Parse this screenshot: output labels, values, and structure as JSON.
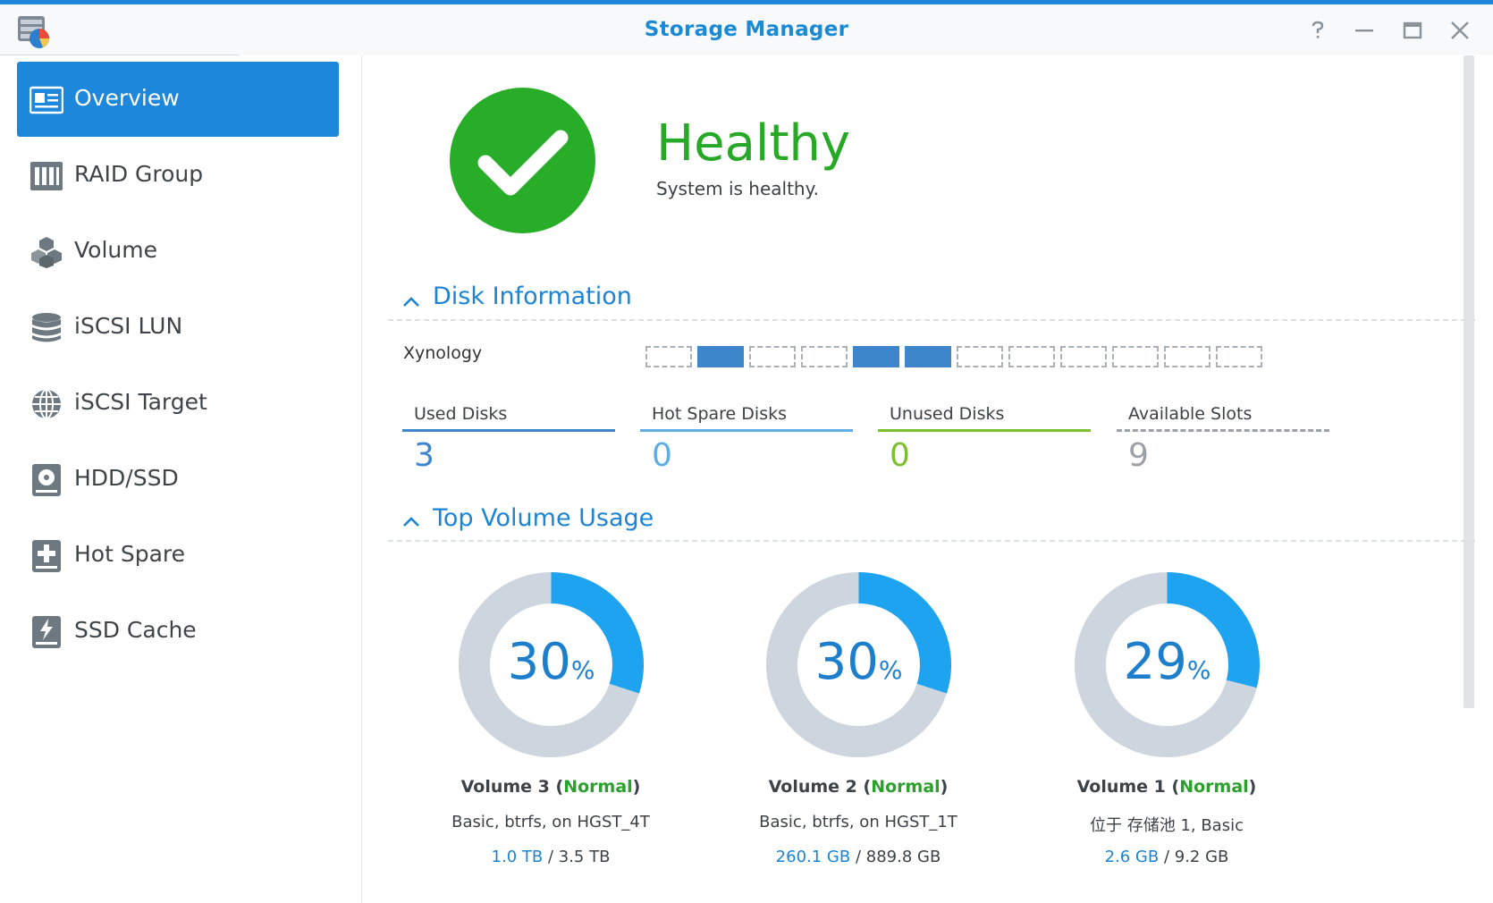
{
  "window": {
    "title": "Storage Manager",
    "accent": "#1f86d8"
  },
  "window_controls": [
    "help-icon",
    "minimize-icon",
    "maximize-icon",
    "close-icon"
  ],
  "sidebar": {
    "items": [
      {
        "label": "Overview",
        "icon": "overview-icon",
        "active": true
      },
      {
        "label": "RAID Group",
        "icon": "raid-group-icon",
        "active": false
      },
      {
        "label": "Volume",
        "icon": "volume-icon",
        "active": false
      },
      {
        "label": "iSCSI LUN",
        "icon": "iscsi-lun-icon",
        "active": false
      },
      {
        "label": "iSCSI Target",
        "icon": "iscsi-target-icon",
        "active": false
      },
      {
        "label": "HDD/SSD",
        "icon": "hdd-ssd-icon",
        "active": false
      },
      {
        "label": "Hot Spare",
        "icon": "hot-spare-icon",
        "active": false
      },
      {
        "label": "SSD Cache",
        "icon": "ssd-cache-icon",
        "active": false
      }
    ]
  },
  "health": {
    "status": "Healthy",
    "message": "System is healthy.",
    "color": "#27ad27"
  },
  "disk_info": {
    "heading": "Disk Information",
    "nas_name": "Xynology",
    "slots": [
      "empty",
      "used",
      "empty",
      "empty",
      "used",
      "used",
      "empty",
      "empty",
      "empty",
      "empty",
      "empty",
      "empty"
    ],
    "stats": [
      {
        "label": "Used Disks",
        "value": "3",
        "color": "#3d86cb",
        "bar": "solid"
      },
      {
        "label": "Hot Spare Disks",
        "value": "0",
        "color": "#5eaee3",
        "bar": "solid"
      },
      {
        "label": "Unused Disks",
        "value": "0",
        "color": "#7cbf2f",
        "bar": "solid"
      },
      {
        "label": "Available Slots",
        "value": "9",
        "color": "#9ba1a6",
        "bar": "dashed"
      }
    ]
  },
  "volume_usage": {
    "heading": "Top Volume Usage",
    "percent_sign": "%",
    "volumes": [
      {
        "name": "Volume 3",
        "status": "Normal",
        "percent": 30,
        "percent_label": "30",
        "desc": "Basic, btrfs, on HGST_4T",
        "used": "1.0 TB",
        "total": "3.5 TB"
      },
      {
        "name": "Volume 2",
        "status": "Normal",
        "percent": 30,
        "percent_label": "30",
        "desc": "Basic, btrfs, on HGST_1T",
        "used": "260.1 GB",
        "total": "889.8 GB"
      },
      {
        "name": "Volume 1",
        "status": "Normal",
        "percent": 29,
        "percent_label": "29",
        "desc": "位于 存储池 1, Basic",
        "used": "2.6 GB",
        "total": "9.2 GB"
      }
    ]
  }
}
